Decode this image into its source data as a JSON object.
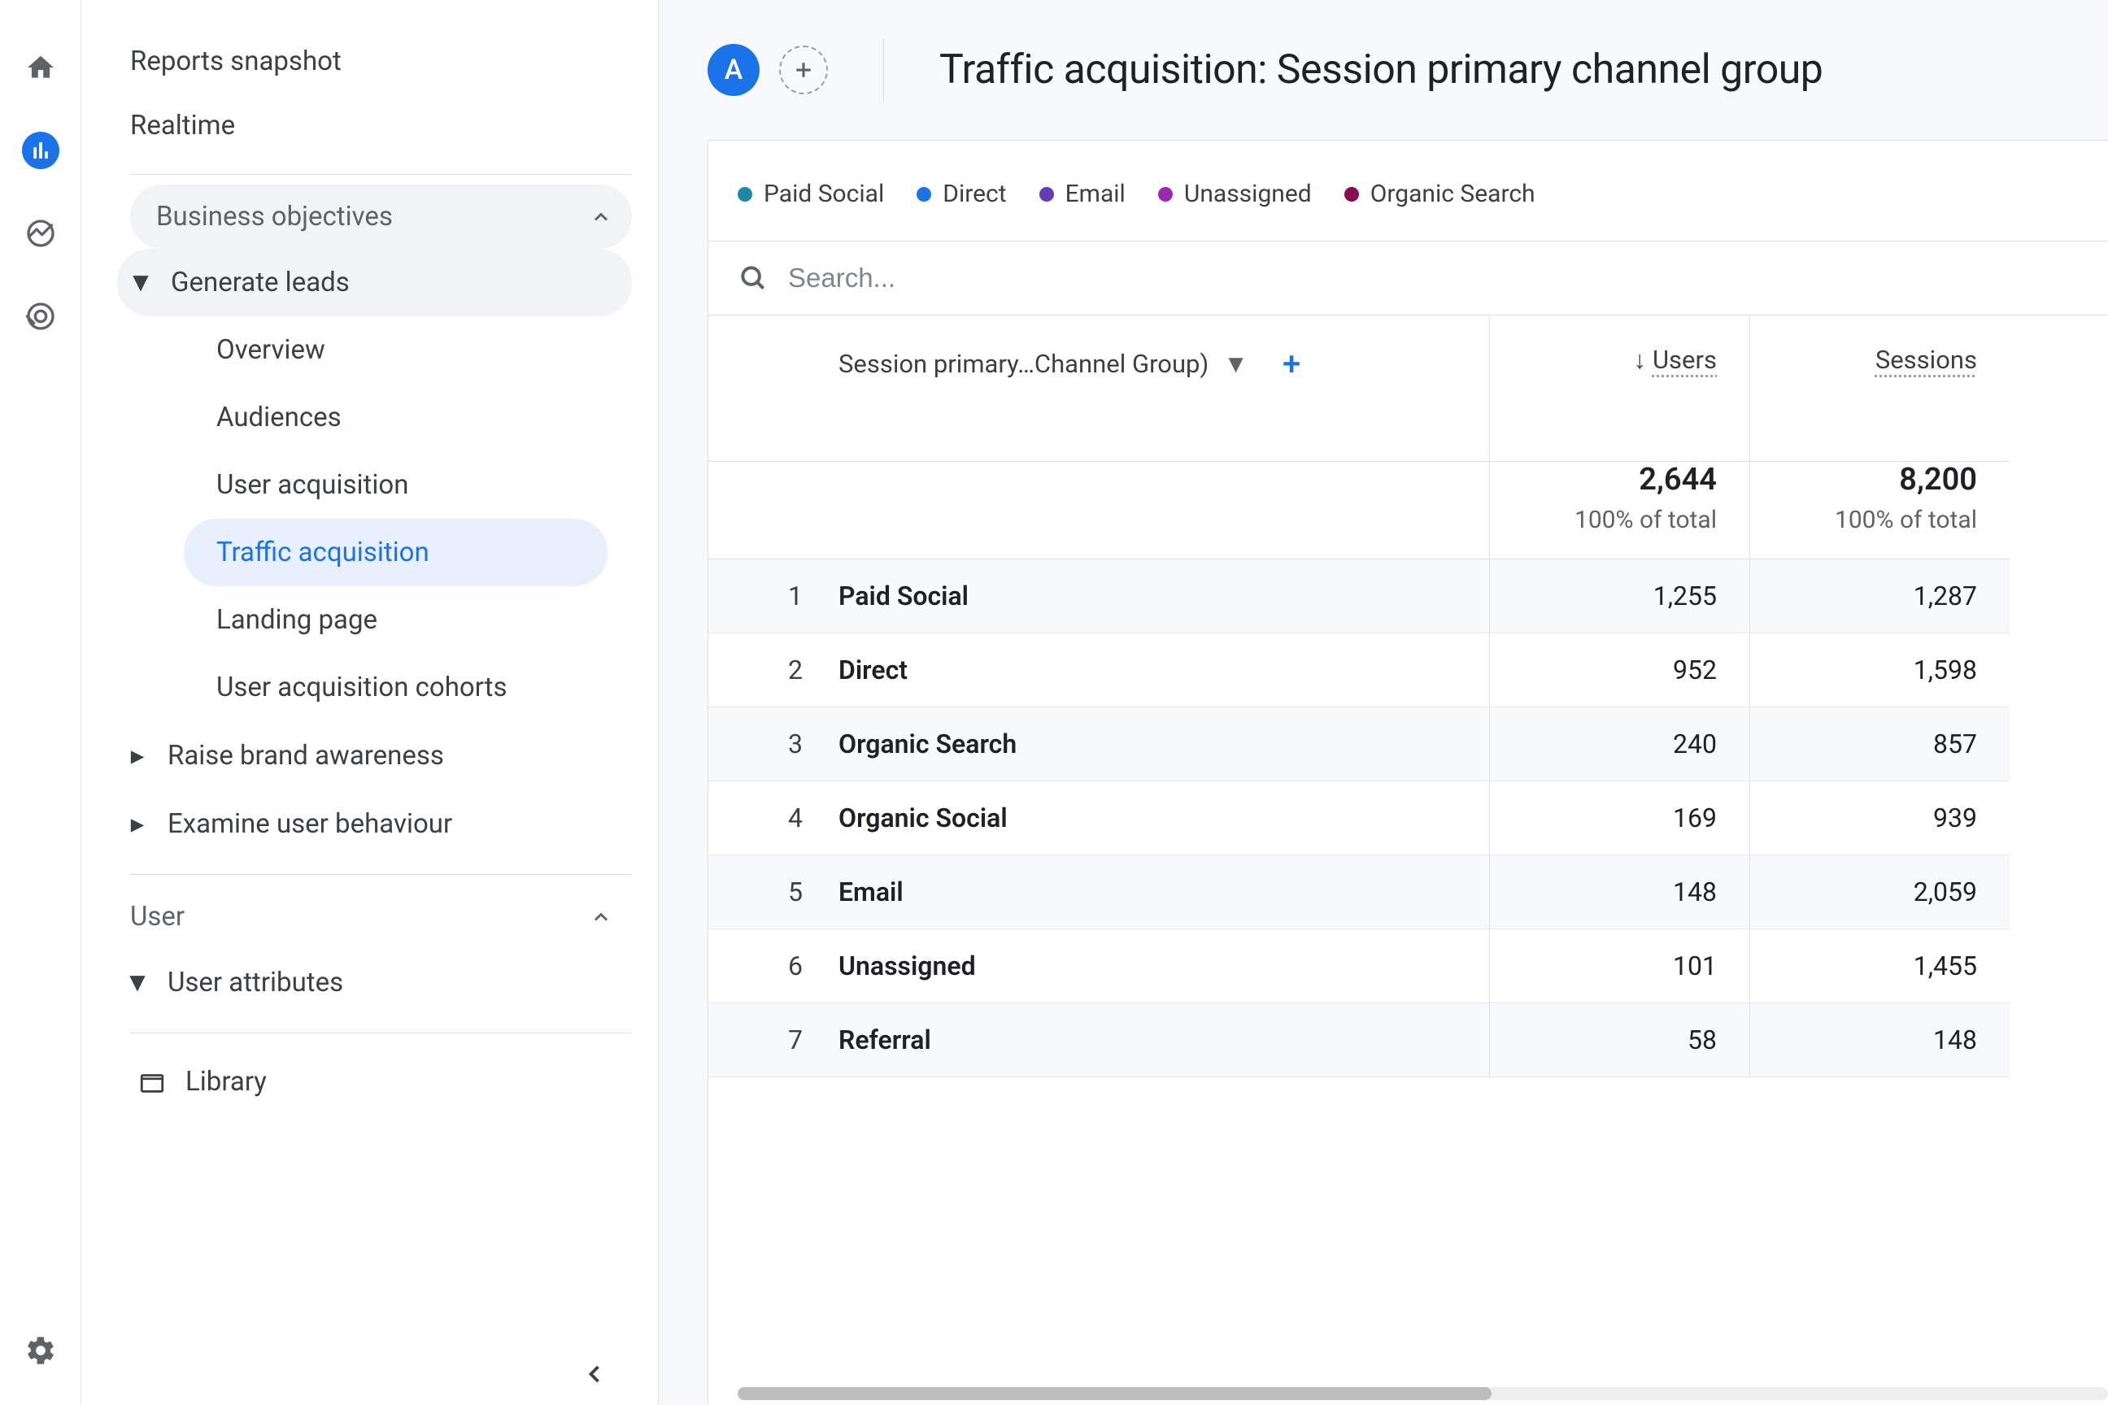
{
  "rail": {
    "avatar_letter": "A"
  },
  "nav": {
    "top": [
      "Reports snapshot",
      "Realtime"
    ],
    "business_objectives_label": "Business objectives",
    "generate_leads_label": "Generate leads",
    "generate_leads_items": [
      "Overview",
      "Audiences",
      "User acquisition",
      "Traffic acquisition",
      "Landing page",
      "User acquisition cohorts"
    ],
    "active_item_index": 3,
    "raise_label": "Raise brand awareness",
    "examine_label": "Examine user behaviour",
    "user_section_label": "User",
    "user_attributes_label": "User attributes",
    "library_label": "Library"
  },
  "header": {
    "chip_letter": "A",
    "title": "Traffic acquisition: Session primary channel group"
  },
  "legend": [
    {
      "label": "Paid Social",
      "color": "#1e88a8"
    },
    {
      "label": "Direct",
      "color": "#1a73e8"
    },
    {
      "label": "Email",
      "color": "#673ab7"
    },
    {
      "label": "Unassigned",
      "color": "#9c27b0"
    },
    {
      "label": "Organic Search",
      "color": "#880e4f"
    }
  ],
  "search": {
    "placeholder": "Search..."
  },
  "table": {
    "dimension_label": "Session primary…Channel Group)",
    "metrics": [
      "Users",
      "Sessions"
    ],
    "sort_metric_index": 0,
    "totals": {
      "users": "2,644",
      "sessions": "8,200",
      "users_sub": "100% of total",
      "sessions_sub": "100% of total"
    },
    "rows": [
      {
        "n": "1",
        "name": "Paid Social",
        "users": "1,255",
        "sessions": "1,287"
      },
      {
        "n": "2",
        "name": "Direct",
        "users": "952",
        "sessions": "1,598"
      },
      {
        "n": "3",
        "name": "Organic Search",
        "users": "240",
        "sessions": "857"
      },
      {
        "n": "4",
        "name": "Organic Social",
        "users": "169",
        "sessions": "939"
      },
      {
        "n": "5",
        "name": "Email",
        "users": "148",
        "sessions": "2,059"
      },
      {
        "n": "6",
        "name": "Unassigned",
        "users": "101",
        "sessions": "1,455"
      },
      {
        "n": "7",
        "name": "Referral",
        "users": "58",
        "sessions": "148"
      }
    ]
  },
  "chart_data": {
    "type": "table",
    "title": "Traffic acquisition: Session primary channel group",
    "dimension": "Session primary channel group",
    "metrics": [
      "Users",
      "Sessions"
    ],
    "rows": [
      {
        "channel": "Paid Social",
        "users": 1255,
        "sessions": 1287
      },
      {
        "channel": "Direct",
        "users": 952,
        "sessions": 1598
      },
      {
        "channel": "Organic Search",
        "users": 240,
        "sessions": 857
      },
      {
        "channel": "Organic Social",
        "users": 169,
        "sessions": 939
      },
      {
        "channel": "Email",
        "users": 148,
        "sessions": 2059
      },
      {
        "channel": "Unassigned",
        "users": 101,
        "sessions": 1455
      },
      {
        "channel": "Referral",
        "users": 58,
        "sessions": 148
      }
    ],
    "totals": {
      "users": 2644,
      "sessions": 8200
    },
    "legend_series": [
      "Paid Social",
      "Direct",
      "Email",
      "Unassigned",
      "Organic Search"
    ]
  }
}
